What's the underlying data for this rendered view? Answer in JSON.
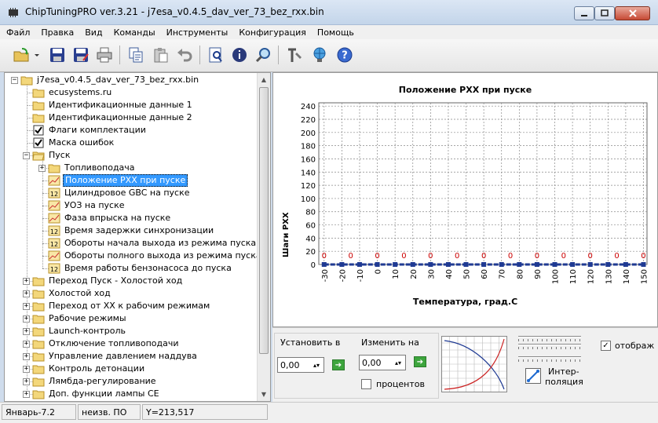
{
  "window": {
    "title": "ChipTuningPRO ver.3.21 - j7esa_v0.4.5_dav_ver_73_bez_rxx.bin"
  },
  "menu": [
    "Файл",
    "Правка",
    "Вид",
    "Команды",
    "Инструменты",
    "Конфигурация",
    "Помощь"
  ],
  "toolbar": [
    {
      "name": "open-icon"
    },
    {
      "name": "dropdown-icon"
    },
    {
      "name": "save-icon"
    },
    {
      "name": "save-as-icon"
    },
    {
      "name": "print-icon"
    },
    {
      "name": "copy-icon"
    },
    {
      "name": "paste-icon"
    },
    {
      "name": "undo-icon"
    },
    {
      "name": "compare-icon"
    },
    {
      "name": "info-icon"
    },
    {
      "name": "search-icon"
    },
    {
      "name": "tools-icon"
    },
    {
      "name": "network-icon"
    },
    {
      "name": "help-icon"
    }
  ],
  "tree": {
    "root": "j7esa_v0.4.5_dav_ver_73_bez_rxx.bin",
    "items": [
      {
        "label": "ecusystems.ru",
        "level": 1,
        "icon": "folder"
      },
      {
        "label": "Идентификационные данные 1",
        "level": 1,
        "icon": "folder"
      },
      {
        "label": "Идентификационные данные 2",
        "level": 1,
        "icon": "folder"
      },
      {
        "label": "Флаги комплектации",
        "level": 1,
        "icon": "check"
      },
      {
        "label": "Маска ошибок",
        "level": 1,
        "icon": "check"
      },
      {
        "label": "Пуск",
        "level": 1,
        "icon": "folder-open",
        "expanded": true
      },
      {
        "label": "Топливоподача",
        "level": 2,
        "icon": "folder",
        "collapsed": true
      },
      {
        "label": "Положение РХХ при пуске",
        "level": 2,
        "icon": "chart",
        "selected": true
      },
      {
        "label": "Цилиндровое GBC на пуске",
        "level": 2,
        "icon": "num"
      },
      {
        "label": "УОЗ на пуске",
        "level": 2,
        "icon": "chart"
      },
      {
        "label": "Фаза впрыска на пуске",
        "level": 2,
        "icon": "chart"
      },
      {
        "label": "Время задержки синхронизации",
        "level": 2,
        "icon": "num"
      },
      {
        "label": "Обороты начала выхода из режима пуска",
        "level": 2,
        "icon": "num"
      },
      {
        "label": "Обороты полного выхода из режима пуска",
        "level": 2,
        "icon": "chart"
      },
      {
        "label": "Время работы бензонасоса до пуска",
        "level": 2,
        "icon": "num"
      },
      {
        "label": "Переход Пуск - Холостой ход",
        "level": 1,
        "icon": "folder",
        "collapsed": true
      },
      {
        "label": "Холостой ход",
        "level": 1,
        "icon": "folder",
        "collapsed": true
      },
      {
        "label": "Переход от ХХ к рабочим режимам",
        "level": 1,
        "icon": "folder",
        "collapsed": true
      },
      {
        "label": "Рабочие режимы",
        "level": 1,
        "icon": "folder",
        "collapsed": true
      },
      {
        "label": "Launch-контроль",
        "level": 1,
        "icon": "folder",
        "collapsed": true
      },
      {
        "label": "Отключение топливоподачи",
        "level": 1,
        "icon": "folder",
        "collapsed": true
      },
      {
        "label": "Управление давлением наддува",
        "level": 1,
        "icon": "folder",
        "collapsed": true
      },
      {
        "label": "Контроль детонации",
        "level": 1,
        "icon": "folder",
        "collapsed": true
      },
      {
        "label": "Лямбда-регулирование",
        "level": 1,
        "icon": "folder",
        "collapsed": true
      },
      {
        "label": "Доп. функции лампы СЕ",
        "level": 1,
        "icon": "folder",
        "collapsed": true
      }
    ],
    "num_icon_text": "12"
  },
  "chart_data": {
    "type": "line",
    "title": "Положение РХХ при пуске",
    "xlabel": "Температура, град.С",
    "ylabel": "Шаги РХХ",
    "x": [
      -30,
      -20,
      -10,
      0,
      10,
      20,
      30,
      40,
      50,
      60,
      70,
      80,
      90,
      100,
      110,
      120,
      130,
      140,
      150
    ],
    "x_ticks": [
      "-30",
      "-20",
      "-10",
      "0",
      "10",
      "20",
      "30",
      "40",
      "50",
      "60",
      "70",
      "80",
      "90",
      "100",
      "110",
      "120",
      "130",
      "140",
      "150"
    ],
    "y_ticks": [
      "0",
      "20",
      "40",
      "60",
      "80",
      "100",
      "120",
      "140",
      "160",
      "180",
      "200",
      "220",
      "240"
    ],
    "ylim": [
      0,
      245
    ],
    "xlim": [
      -33,
      152
    ],
    "series": [
      {
        "values": [
          0,
          0,
          0,
          0,
          0,
          0,
          0,
          0,
          0,
          0,
          0,
          0,
          0,
          0,
          0,
          0,
          0,
          0,
          0
        ],
        "color": "#1f3a93"
      }
    ],
    "data_labels": [
      "0",
      "0",
      "0",
      "0",
      "0",
      "0",
      "0",
      "0",
      "0",
      "0",
      "0",
      "0",
      "0"
    ],
    "label_color": "#cc0000",
    "grid": true
  },
  "controls": {
    "set_to_label": "Установить в",
    "set_to_value": "0,00",
    "change_by_label": "Изменить на",
    "change_by_value": "0,00",
    "percent_label": "процентов",
    "interp_label_1": "Интер-",
    "interp_label_2": "поляция",
    "display_label": "отображ",
    "display_checked": "✓"
  },
  "status": {
    "cell1": "Январь-7.2",
    "cell2": "неизв. ПО",
    "cell3": "Y=213,517"
  }
}
